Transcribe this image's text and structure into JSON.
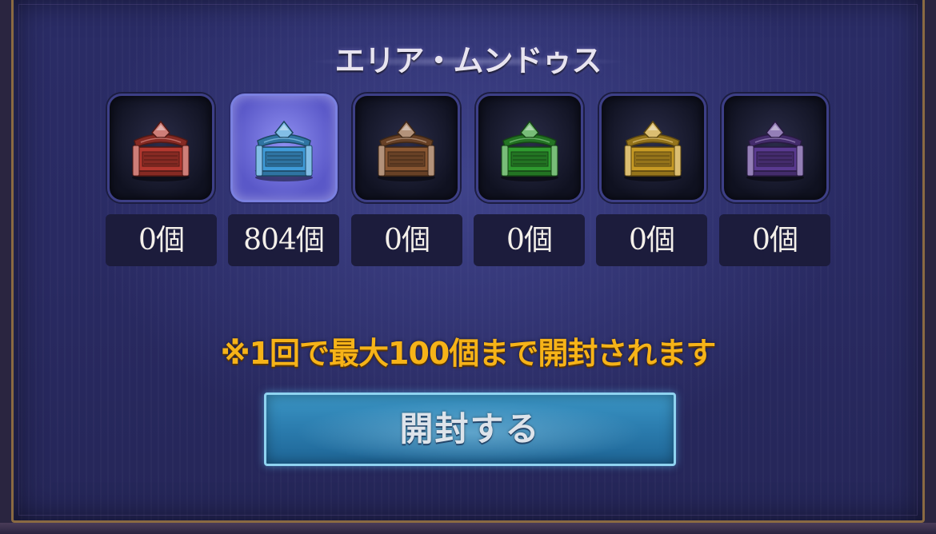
{
  "panel": {
    "title": "エリア・ムンドゥス"
  },
  "chests": [
    {
      "color_name": "red",
      "color": "#b3382f",
      "count": "0個",
      "selected": false
    },
    {
      "color_name": "blue",
      "color": "#3f9bd8",
      "count": "804個",
      "selected": true
    },
    {
      "color_name": "brown",
      "color": "#8a5732",
      "count": "0個",
      "selected": false
    },
    {
      "color_name": "green",
      "color": "#2f9a2f",
      "count": "0個",
      "selected": false
    },
    {
      "color_name": "gold",
      "color": "#c79a24",
      "count": "0個",
      "selected": false
    },
    {
      "color_name": "purple",
      "color": "#5a3a90",
      "count": "0個",
      "selected": false
    }
  ],
  "notice": "※1回で最大100個まで開封されます",
  "open_button": {
    "label": "開封する"
  },
  "colors": {
    "frame_border": "#8a6a42",
    "panel_background": "#292a62",
    "notice_text": "#f6b318",
    "button_fill": "#2c7eb0",
    "button_border": "#8fd3f0"
  }
}
